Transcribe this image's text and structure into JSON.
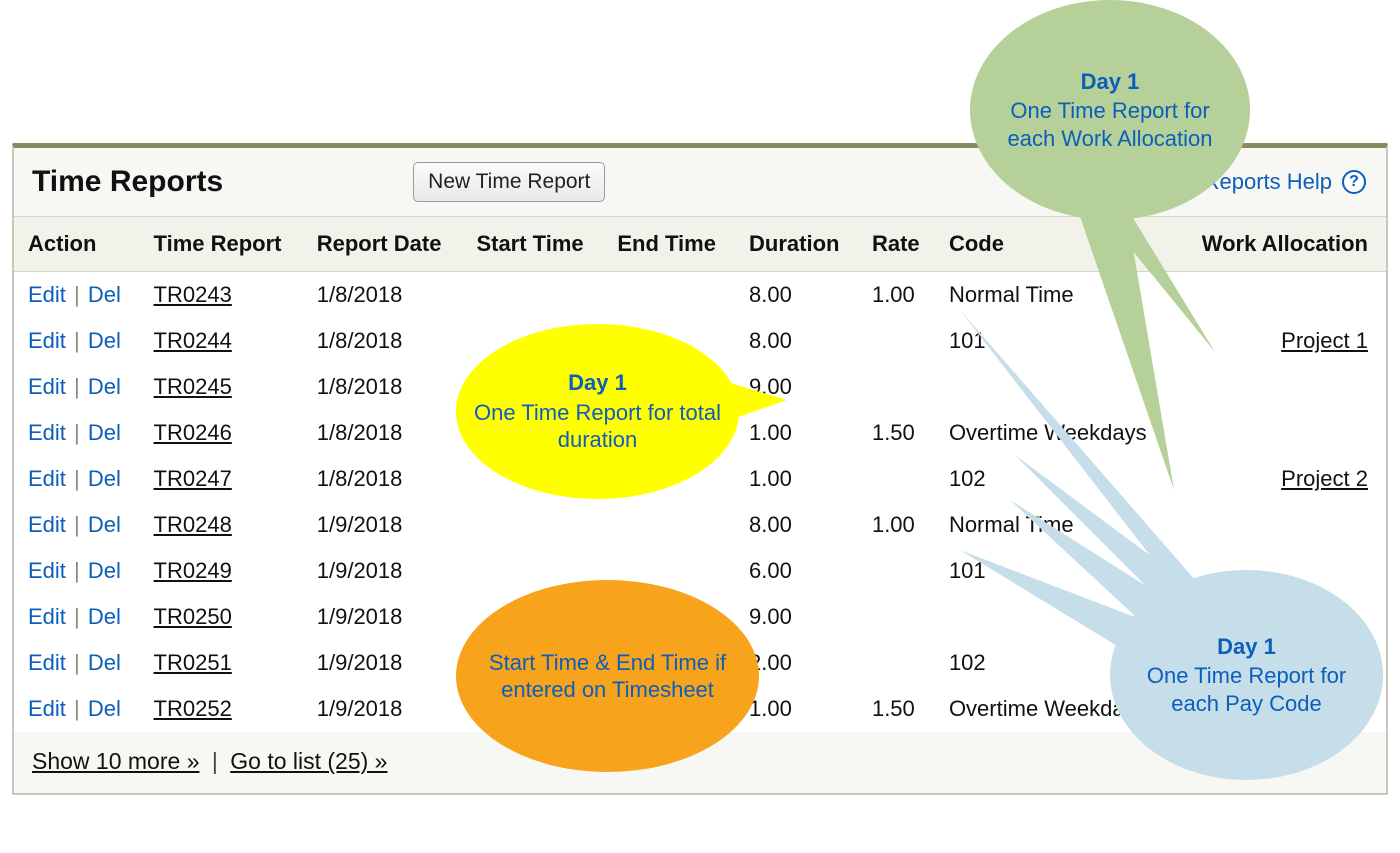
{
  "title": "Time Reports",
  "new_button": "New Time Report",
  "help_link": "Time Reports Help",
  "actions": {
    "edit": "Edit",
    "del": "Del"
  },
  "columns": {
    "action": "Action",
    "time_report": "Time Report",
    "report_date": "Report Date",
    "start_time": "Start Time",
    "end_time": "End Time",
    "duration": "Duration",
    "rate": "Rate",
    "code": "Code",
    "work_allocation": "Work Allocation"
  },
  "rows": [
    {
      "id": "TR0243",
      "date": "1/8/2018",
      "start": "",
      "end": "",
      "duration": "8.00",
      "rate": "1.00",
      "code": "Normal Time",
      "wa": ""
    },
    {
      "id": "TR0244",
      "date": "1/8/2018",
      "start": "",
      "end": "",
      "duration": "8.00",
      "rate": "",
      "code": "101",
      "wa": "Project 1"
    },
    {
      "id": "TR0245",
      "date": "1/8/2018",
      "start": "",
      "end": "",
      "duration": "9.00",
      "rate": "",
      "code": "",
      "wa": ""
    },
    {
      "id": "TR0246",
      "date": "1/8/2018",
      "start": "",
      "end": "",
      "duration": "1.00",
      "rate": "1.50",
      "code": "Overtime Weekdays",
      "wa": ""
    },
    {
      "id": "TR0247",
      "date": "1/8/2018",
      "start": "",
      "end": "",
      "duration": "1.00",
      "rate": "",
      "code": "102",
      "wa": "Project 2"
    },
    {
      "id": "TR0248",
      "date": "1/9/2018",
      "start": "",
      "end": "",
      "duration": "8.00",
      "rate": "1.00",
      "code": "Normal Time",
      "wa": ""
    },
    {
      "id": "TR0249",
      "date": "1/9/2018",
      "start": "",
      "end": "",
      "duration": "6.00",
      "rate": "",
      "code": "101",
      "wa": ""
    },
    {
      "id": "TR0250",
      "date": "1/9/2018",
      "start": "",
      "end": "",
      "duration": "9.00",
      "rate": "",
      "code": "",
      "wa": ""
    },
    {
      "id": "TR0251",
      "date": "1/9/2018",
      "start": "",
      "end": "",
      "duration": "2.00",
      "rate": "",
      "code": "102",
      "wa": ""
    },
    {
      "id": "TR0252",
      "date": "1/9/2018",
      "start": "",
      "end": "",
      "duration": "1.00",
      "rate": "1.50",
      "code": "Overtime Weekdays",
      "wa": ""
    }
  ],
  "footer": {
    "show_more": "Show 10 more »",
    "go_to_list": "Go to list (25) »"
  },
  "callouts": {
    "green": {
      "title": "Day 1",
      "body": "One Time Report for each Work Allocation"
    },
    "yellow": {
      "title": "Day 1",
      "body": "One Time Report for total duration"
    },
    "orange": {
      "title": "",
      "body": "Start Time & End Time if entered on Timesheet"
    },
    "blue": {
      "title": "Day 1",
      "body": "One Time Report for each Pay Code"
    }
  }
}
